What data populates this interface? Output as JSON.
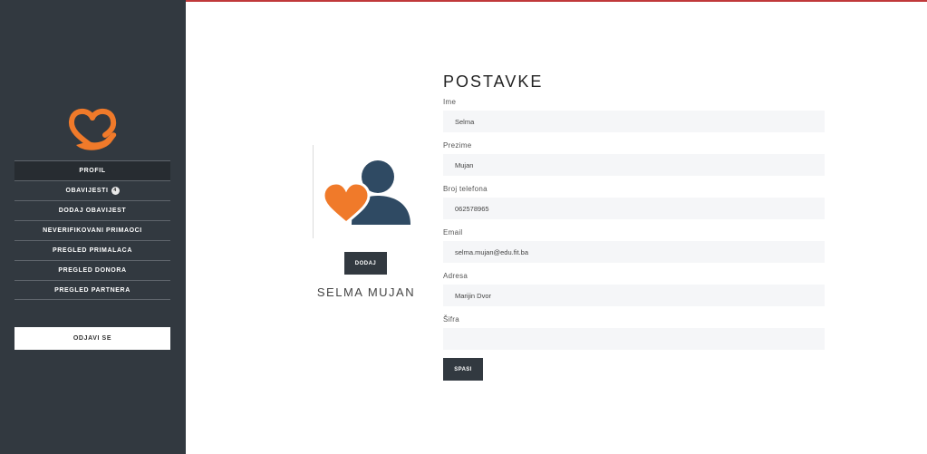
{
  "sidebar": {
    "nav": {
      "profil": "PROFIL",
      "obavijesti": "OBAVIJESTI",
      "obavijesti_count": "4",
      "dodaj_obavijest": "DODAJ OBAVIJEST",
      "neverifikovani": "NEVERIFIKOVANI PRIMAOCI",
      "primalaca": "PREGLED PRIMALACA",
      "donora": "PREGLED DONORA",
      "partnera": "PREGLED PARTNERA"
    },
    "logout_label": "ODJAVI SE"
  },
  "profile": {
    "add_label": "DODAJ",
    "name": "SELMA MUJAN"
  },
  "form": {
    "title": "POSTAVKE",
    "ime": {
      "label": "Ime",
      "value": "Selma"
    },
    "prezime": {
      "label": "Prezime",
      "value": "Mujan"
    },
    "telefon": {
      "label": "Broj telefona",
      "value": "062578965"
    },
    "email": {
      "label": "Email",
      "value": "selma.mujan@edu.fit.ba"
    },
    "adresa": {
      "label": "Adresa",
      "value": "Marijin Dvor"
    },
    "sifra": {
      "label": "Šifra",
      "value": ""
    },
    "save_label": "SPASI"
  },
  "colors": {
    "sidebar": "#323940",
    "accent": "#c0393b",
    "logo_orange": "#f07a2a",
    "avatar_blue": "#2f4a63"
  },
  "icons": {
    "logo": "heart-hand-icon",
    "avatar": "heart-user-icon"
  }
}
